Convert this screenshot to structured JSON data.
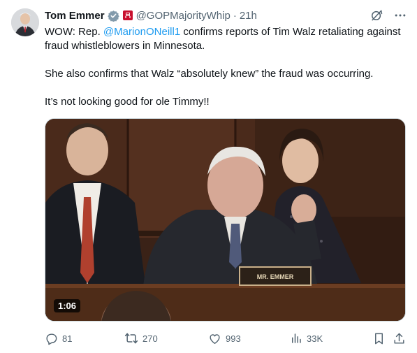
{
  "author": {
    "name": "Tom Emmer",
    "handle": "@GOPMajorityWhip",
    "separator": "·",
    "time": "21h"
  },
  "tweet": {
    "line1_pre": "WOW: Rep. ",
    "mention": "@MarionONeill1",
    "line1_post": " confirms reports of Tim Walz retaliating against fraud whistleblowers in Minnesota.",
    "para2": "She also confirms that Walz “absolutely knew” the fraud was occurring.",
    "para3": "It’s not looking good for ole Timmy!!"
  },
  "media": {
    "duration": "1:06",
    "nameplate": "MR. EMMER"
  },
  "actions": {
    "replies": "81",
    "reposts": "270",
    "likes": "993",
    "views": "33K"
  },
  "colors": {
    "accent": "#1d9bf0",
    "muted": "#536471",
    "verified_badge": "#829aab",
    "flag": "#c8102e"
  },
  "icons": [
    "verified-badge-icon",
    "republican-flag-icon",
    "grok-icon",
    "more-icon",
    "reply-icon",
    "repost-icon",
    "like-icon",
    "views-icon",
    "bookmark-icon",
    "share-icon"
  ]
}
